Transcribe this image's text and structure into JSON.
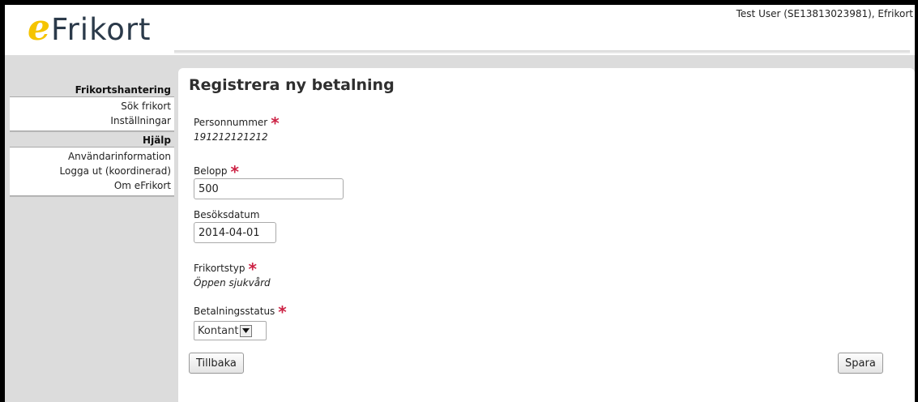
{
  "header": {
    "logo_e": "e",
    "logo_text": "Frikort",
    "user_info": "Test User (SE13813023981), Efrikort"
  },
  "sidebar": {
    "sections": [
      {
        "title": "Frikortshantering",
        "items": [
          "Sök frikort",
          "Inställningar"
        ]
      },
      {
        "title": "Hjälp",
        "items": [
          "Användarinformation",
          "Logga ut (koordinerad)",
          "Om eFrikort"
        ]
      }
    ]
  },
  "form": {
    "title": "Registrera ny betalning",
    "personnummer_label": "Personnummer",
    "personnummer_value": "191212121212",
    "belopp_label": "Belopp",
    "belopp_value": "500",
    "besoksdatum_label": "Besöksdatum",
    "besoksdatum_value": "2014-04-01",
    "frikortstyp_label": "Frikortstyp",
    "frikortstyp_value": "Öppen sjukvård",
    "betalningsstatus_label": "Betalningsstatus",
    "betalningsstatus_value": "Kontant",
    "required_marker": "*",
    "back_button": "Tillbaka",
    "save_button": "Spara"
  },
  "colors": {
    "logo_e": "#f5c400",
    "required": "#cc2244",
    "background": "#dcdcdc"
  }
}
